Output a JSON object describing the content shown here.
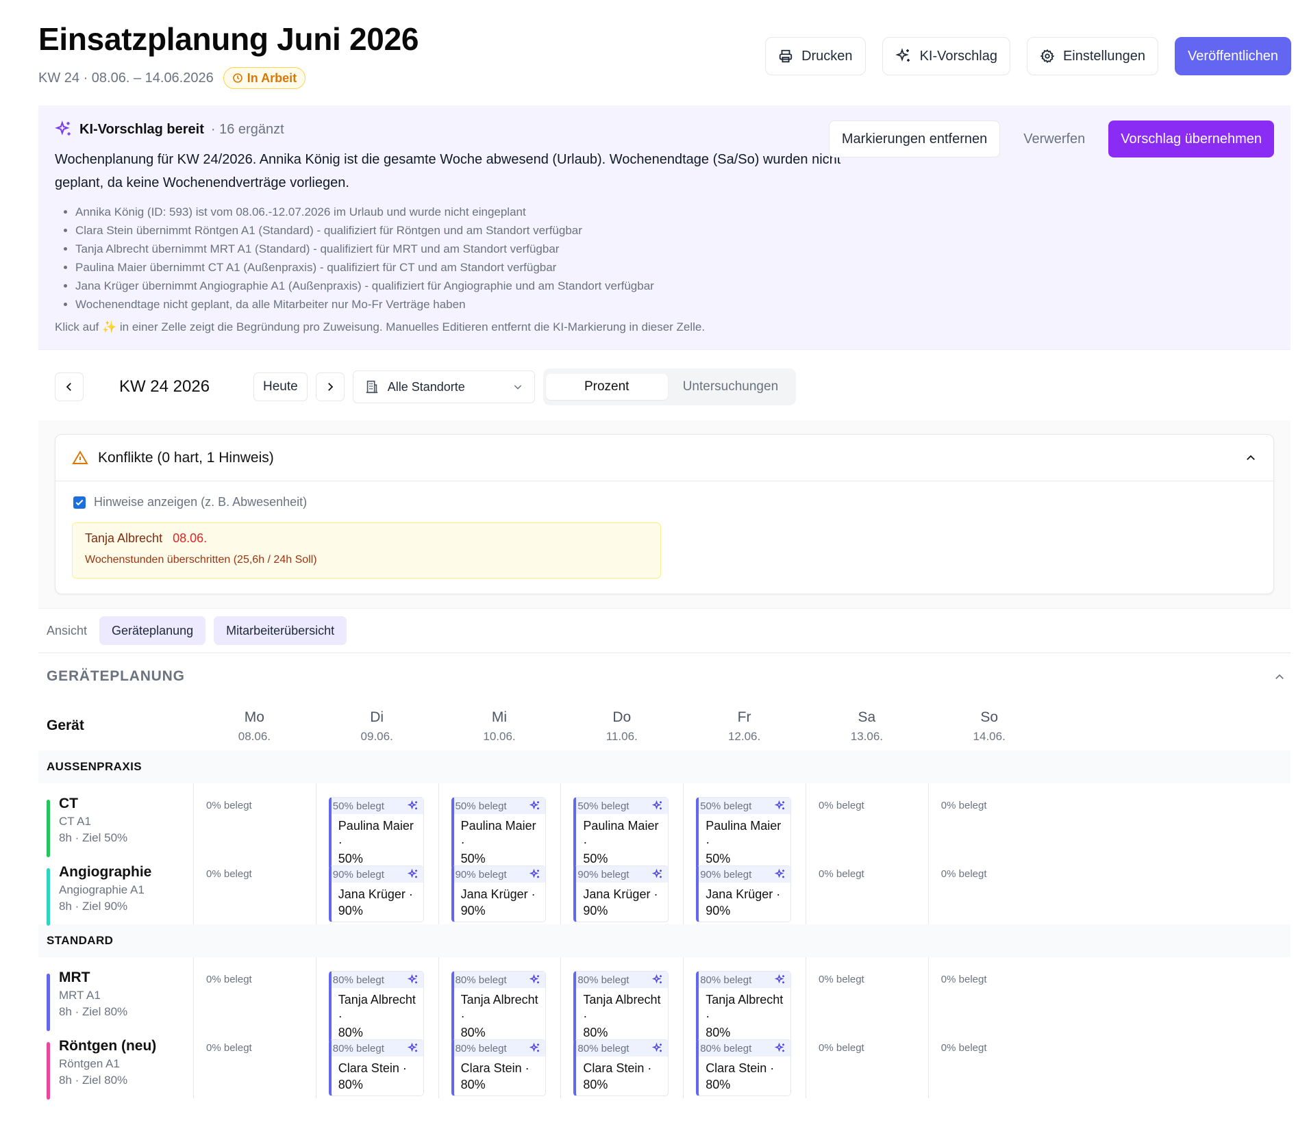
{
  "header": {
    "title": "Einsatzplanung Juni 2026",
    "subtitle": "KW 24 · 08.06. – 14.06.2026",
    "status": "In Arbeit",
    "buttons": {
      "print": "Drucken",
      "ai": "KI-Vorschlag",
      "settings": "Einstellungen",
      "publish": "Veröffentlichen"
    }
  },
  "ai_panel": {
    "title": "KI-Vorschlag bereit",
    "count": "· 16 ergänzt",
    "description": "Wochenplanung für KW 24/2026. Annika König ist die gesamte Woche abwesend (Urlaub). Wochenendtage (Sa/So) wurden nicht geplant, da keine Wochenendverträge vorliegen.",
    "bullets": [
      "Annika König (ID: 593) ist vom 08.06.-12.07.2026 im Urlaub und wurde nicht eingeplant",
      "Clara Stein übernimmt Röntgen A1 (Standard) - qualifiziert für Röntgen und am Standort verfügbar",
      "Tanja Albrecht übernimmt MRT A1 (Standard) - qualifiziert für MRT und am Standort verfügbar",
      "Paulina Maier übernimmt CT A1 (Außenpraxis) - qualifiziert für CT und am Standort verfügbar",
      "Jana Krüger übernimmt Angiographie A1 (Außenpraxis) - qualifiziert für Angiographie und am Standort verfügbar",
      "Wochenendtage nicht geplant, da alle Mitarbeiter nur Mo-Fr Verträge haben"
    ],
    "footer": "Klick auf ✨ in einer Zelle zeigt die Begründung pro Zuweisung. Manuelles Editieren entfernt die KI-Markierung in dieser Zelle.",
    "buttons": {
      "remove_marks": "Markierungen entfernen",
      "discard": "Verwerfen",
      "accept": "Vorschlag übernehmen"
    }
  },
  "toolbar": {
    "week": "KW 24 2026",
    "today": "Heute",
    "location": "Alle Standorte",
    "modes": [
      "Prozent",
      "Untersuchungen"
    ],
    "active_mode": "Prozent"
  },
  "conflicts": {
    "title": "Konflikte (0 hart, 1 Hinweis)",
    "show_hints_label": "Hinweise anzeigen (z. B. Abwesenheit)",
    "show_hints_checked": true,
    "items": [
      {
        "name": "Tanja Albrecht",
        "date": "08.06.",
        "message": "Wochenstunden überschritten (25,6h / 24h Soll)"
      }
    ]
  },
  "view": {
    "label": "Ansicht",
    "tabs": [
      "Geräteplanung",
      "Mitarbeiterübersicht"
    ]
  },
  "planning": {
    "section_title": "GERÄTEPLANUNG",
    "device_header": "Gerät",
    "days": [
      {
        "name": "Mo",
        "date": "08.06."
      },
      {
        "name": "Di",
        "date": "09.06."
      },
      {
        "name": "Mi",
        "date": "10.06."
      },
      {
        "name": "Do",
        "date": "11.06."
      },
      {
        "name": "Fr",
        "date": "12.06."
      },
      {
        "name": "Sa",
        "date": "13.06."
      },
      {
        "name": "So",
        "date": "14.06."
      }
    ],
    "groups": [
      {
        "name": "AUSSENPRAXIS",
        "devices": [
          {
            "name": "CT",
            "sub": "CT A1",
            "meta": "8h · Ziel 50%",
            "color": "#22c55e",
            "cells": [
              {
                "label": "0% belegt"
              },
              {
                "label": "50% belegt",
                "person": "Paulina Maier ·",
                "pct": "50%",
                "ai": true
              },
              {
                "label": "50% belegt",
                "person": "Paulina Maier ·",
                "pct": "50%",
                "ai": true
              },
              {
                "label": "50% belegt",
                "person": "Paulina Maier ·",
                "pct": "50%",
                "ai": true
              },
              {
                "label": "50% belegt",
                "person": "Paulina Maier ·",
                "pct": "50%",
                "ai": true
              },
              {
                "label": "0% belegt"
              },
              {
                "label": "0% belegt"
              }
            ]
          },
          {
            "name": "Angiographie",
            "sub": "Angiographie A1",
            "meta": "8h · Ziel 90%",
            "color": "#2dd4bf",
            "cells": [
              {
                "label": "0% belegt"
              },
              {
                "label": "90% belegt",
                "person": "Jana Krüger · 90%",
                "ai": true
              },
              {
                "label": "90% belegt",
                "person": "Jana Krüger · 90%",
                "ai": true
              },
              {
                "label": "90% belegt",
                "person": "Jana Krüger · 90%",
                "ai": true
              },
              {
                "label": "90% belegt",
                "person": "Jana Krüger · 90%",
                "ai": true
              },
              {
                "label": "0% belegt"
              },
              {
                "label": "0% belegt"
              }
            ]
          }
        ]
      },
      {
        "name": "STANDARD",
        "devices": [
          {
            "name": "MRT",
            "sub": "MRT A1",
            "meta": "8h · Ziel 80%",
            "color": "#6366f1",
            "cells": [
              {
                "label": "0% belegt"
              },
              {
                "label": "80% belegt",
                "person": "Tanja Albrecht ·",
                "pct": "80%",
                "ai": true
              },
              {
                "label": "80% belegt",
                "person": "Tanja Albrecht ·",
                "pct": "80%",
                "ai": true
              },
              {
                "label": "80% belegt",
                "person": "Tanja Albrecht ·",
                "pct": "80%",
                "ai": true
              },
              {
                "label": "80% belegt",
                "person": "Tanja Albrecht ·",
                "pct": "80%",
                "ai": true
              },
              {
                "label": "0% belegt"
              },
              {
                "label": "0% belegt"
              }
            ]
          },
          {
            "name": "Röntgen (neu)",
            "sub": "Röntgen A1",
            "meta": "8h · Ziel 80%",
            "color": "#ec4899",
            "cells": [
              {
                "label": "0% belegt"
              },
              {
                "label": "80% belegt",
                "person": "Clara Stein · 80%",
                "ai": true
              },
              {
                "label": "80% belegt",
                "person": "Clara Stein · 80%",
                "ai": true
              },
              {
                "label": "80% belegt",
                "person": "Clara Stein · 80%",
                "ai": true
              },
              {
                "label": "80% belegt",
                "person": "Clara Stein · 80%",
                "ai": true
              },
              {
                "label": "0% belegt"
              },
              {
                "label": "0% belegt"
              }
            ]
          }
        ]
      }
    ]
  }
}
